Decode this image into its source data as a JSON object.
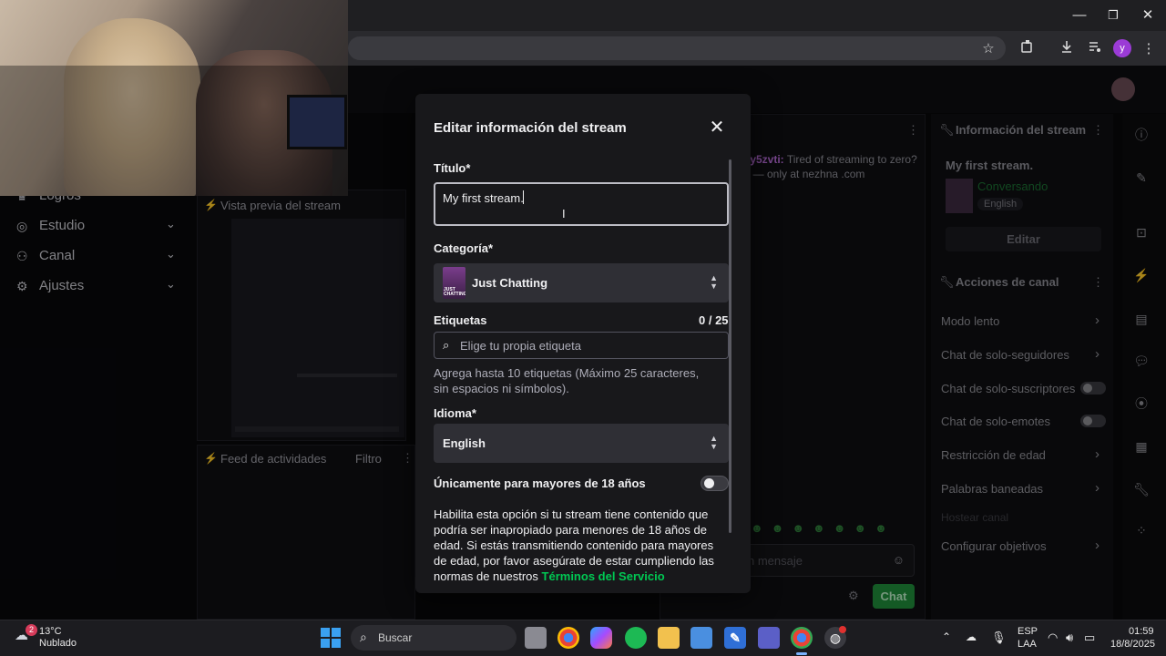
{
  "browser": {
    "window_controls": [
      "—",
      "❐",
      "✕"
    ],
    "profile_initial": "y"
  },
  "nav": {
    "items": [
      {
        "label": "Logros"
      },
      {
        "label": "Estudio"
      },
      {
        "label": "Canal"
      },
      {
        "label": "Ajustes"
      }
    ]
  },
  "center": {
    "preview_title": "Vista previa del stream",
    "feed_title": "Feed de actividades",
    "feed_filter": "Filtro"
  },
  "chat": {
    "username": "ly5zvti:",
    "message_line1": "Tired of streaming to zero?",
    "message_line2": "t — only at nezhna .com",
    "input_placeholder": "n mensaje",
    "send_label": "Chat"
  },
  "stream_info": {
    "panel_title": "Información del stream",
    "title": "My first stream.",
    "category": "Conversando",
    "language": "English",
    "edit_label": "Editar"
  },
  "channel_actions": {
    "panel_title": "Acciones de canal",
    "items": [
      {
        "label": "Modo lento",
        "control": "chevron"
      },
      {
        "label": "Chat de solo-seguidores",
        "control": "chevron"
      },
      {
        "label": "Chat de solo-suscriptores",
        "control": "toggle"
      },
      {
        "label": "Chat de solo-emotes",
        "control": "toggle"
      },
      {
        "label": "Restricción de edad",
        "control": "chevron"
      },
      {
        "label": "Palabras baneadas",
        "control": "chevron"
      },
      {
        "label": "Hostear canal",
        "control": "none"
      },
      {
        "label": "Configurar objetivos",
        "control": "chevron"
      }
    ]
  },
  "modal": {
    "title": "Editar información del stream",
    "title_label": "Título*",
    "title_value": "My first stream.",
    "category_label": "Categoría*",
    "category_value": "Just Chatting",
    "category_thumb_text": "JUST CHATTING",
    "tags_label": "Etiquetas",
    "tags_count": "0 / 25",
    "tags_placeholder": "Elige tu propia etiqueta",
    "tags_help": "Agrega hasta 10 etiquetas (Máximo 25 caracteres, sin espacios ni símbolos).",
    "language_label": "Idioma*",
    "language_value": "English",
    "mature_label": "Únicamente para mayores de 18 años",
    "mature_enabled": false,
    "mature_help": "Habilita esta opción si tu stream tiene contenido que podría ser inapropiado para menores de 18 años de edad. Si estás transmitiendo contenido para mayores de edad, por favor asegúrate de estar cumpliendo las normas de nuestros",
    "tos_link": "Términos del Servicio"
  },
  "taskbar": {
    "weather_badge": "2",
    "temperature": "13°C",
    "weather": "Nublado",
    "search_placeholder": "Buscar",
    "lang_primary": "ESP",
    "lang_secondary": "LAA",
    "time": "01:59",
    "date": "18/8/2025"
  },
  "colors": {
    "accent_purple": "#9147ff",
    "link_green": "#00c853",
    "chat_button": "#1f8b3a",
    "category_green": "#1db954"
  }
}
